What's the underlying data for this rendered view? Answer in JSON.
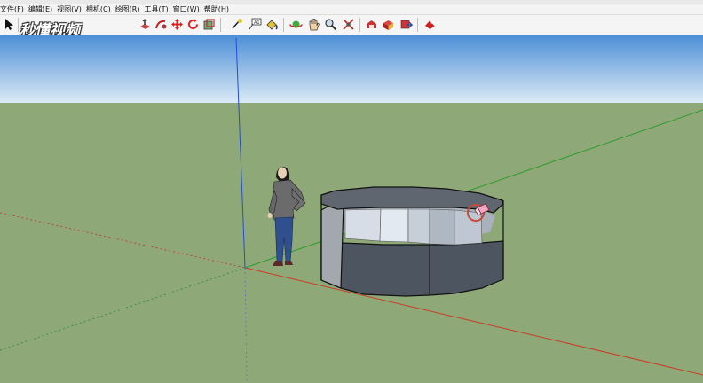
{
  "menu": {
    "items": [
      "文件(F)",
      "编辑(E)",
      "视图(V)",
      "相机(C)",
      "绘图(R)",
      "工具(T)",
      "窗口(W)",
      "帮助(H)"
    ]
  },
  "watermark": {
    "text": "秒懂视频"
  },
  "toolbar": {
    "tools": [
      {
        "name": "select-tool",
        "icon": "arrow-cursor-icon"
      },
      {
        "name": "line-tool",
        "icon": "pencil-icon"
      },
      {
        "name": "rectangle-tool",
        "icon": "rectangle-icon"
      },
      {
        "name": "circle-tool",
        "icon": "circle-icon"
      },
      {
        "name": "polygon-tool",
        "icon": "polygon-icon"
      },
      {
        "name": "arc-tool",
        "icon": "arc-icon"
      },
      {
        "name": "freehand-tool",
        "icon": "freehand-icon"
      },
      {
        "name": "eraser-tool",
        "icon": "eraser-icon"
      },
      {
        "name": "push-pull-tool",
        "icon": "push-pull-icon"
      },
      {
        "name": "follow-me-tool",
        "icon": "follow-me-icon"
      },
      {
        "name": "move-tool",
        "icon": "move-icon"
      },
      {
        "name": "rotate-tool",
        "icon": "rotate-icon"
      },
      {
        "name": "scale-tool",
        "icon": "scale-icon"
      },
      {
        "name": "tape-measure-tool",
        "icon": "tape-measure-icon"
      },
      {
        "name": "text-tool",
        "icon": "text-icon"
      },
      {
        "name": "paint-bucket-tool",
        "icon": "paint-bucket-icon"
      },
      {
        "name": "orbit-tool",
        "icon": "orbit-icon"
      },
      {
        "name": "pan-tool",
        "icon": "pan-hand-icon"
      },
      {
        "name": "zoom-tool",
        "icon": "zoom-magnifier-icon"
      },
      {
        "name": "zoom-extents-tool",
        "icon": "zoom-extents-icon"
      },
      {
        "name": "warehouse-tool",
        "icon": "warehouse-icon"
      },
      {
        "name": "components-tool",
        "icon": "components-icon"
      },
      {
        "name": "share-model-tool",
        "icon": "share-model-icon"
      },
      {
        "name": "extension-tool",
        "icon": "extension-icon"
      }
    ]
  },
  "colors": {
    "sky_top": "#4d8fd6",
    "sky_bottom": "#dceaf6",
    "ground": "#8fa878",
    "axis_red": "#c83c28",
    "axis_green": "#2f9b2f",
    "axis_blue": "#2050d8",
    "cylinder_top": "#5f6670",
    "cylinder_side": "#4d5560"
  }
}
